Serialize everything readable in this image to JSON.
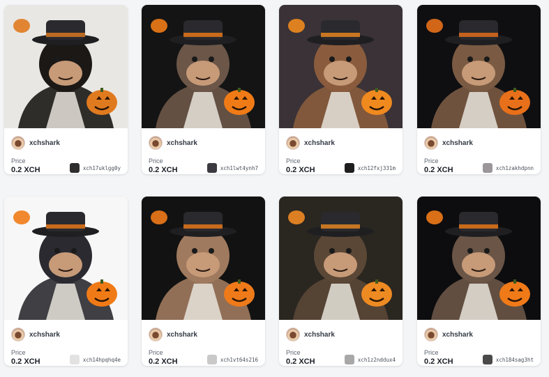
{
  "cards": [
    {
      "creator": "xchshark",
      "price_label": "Price",
      "price": "0.2 XCH",
      "token": "xch17uklgg0y",
      "swatch": "#2d2d2d",
      "bg": "#e9e7e3",
      "fg": "#1b1815",
      "accent": "#e07a1f"
    },
    {
      "creator": "xchshark",
      "price_label": "Price",
      "price": "0.2 XCH",
      "token": "xch1lwt4ynh7",
      "swatch": "#3a3a40",
      "bg": "#141414",
      "fg": "#6b5648",
      "accent": "#f07b16"
    },
    {
      "creator": "xchshark",
      "price_label": "Price",
      "price": "0.2 XCH",
      "token": "xch12fxj331m",
      "swatch": "#1e1e1e",
      "bg": "#3a3236",
      "fg": "#8a5c3d",
      "accent": "#f08a1e"
    },
    {
      "creator": "xchshark",
      "price_label": "Price",
      "price": "0.2 XCH",
      "token": "xch1zakhdpnn",
      "swatch": "#9a969a",
      "bg": "#0f0f12",
      "fg": "#7a5a42",
      "accent": "#e8701a"
    },
    {
      "creator": "xchshark",
      "price_label": "Price",
      "price": "0.2 XCH",
      "token": "xch14hpqhq4e",
      "swatch": "#e2e2e2",
      "bg": "#f7f7f7",
      "fg": "#2a2a30",
      "accent": "#f07b16"
    },
    {
      "creator": "xchshark",
      "price_label": "Price",
      "price": "0.2 XCH",
      "token": "xch1vt64s216",
      "swatch": "#c9c9c9",
      "bg": "#121212",
      "fg": "#a07a5e",
      "accent": "#ef7a1a"
    },
    {
      "creator": "xchshark",
      "price_label": "Price",
      "price": "0.2 XCH",
      "token": "xch1z2nddux4",
      "swatch": "#a8a8a8",
      "bg": "#2a2620",
      "fg": "#5a4736",
      "accent": "#ee8a22"
    },
    {
      "creator": "xchshark",
      "price_label": "Price",
      "price": "0.2 XCH",
      "token": "xch184sag3ht",
      "swatch": "#4a4a4a",
      "bg": "#0d0d0f",
      "fg": "#6a5546",
      "accent": "#f07a18"
    }
  ]
}
